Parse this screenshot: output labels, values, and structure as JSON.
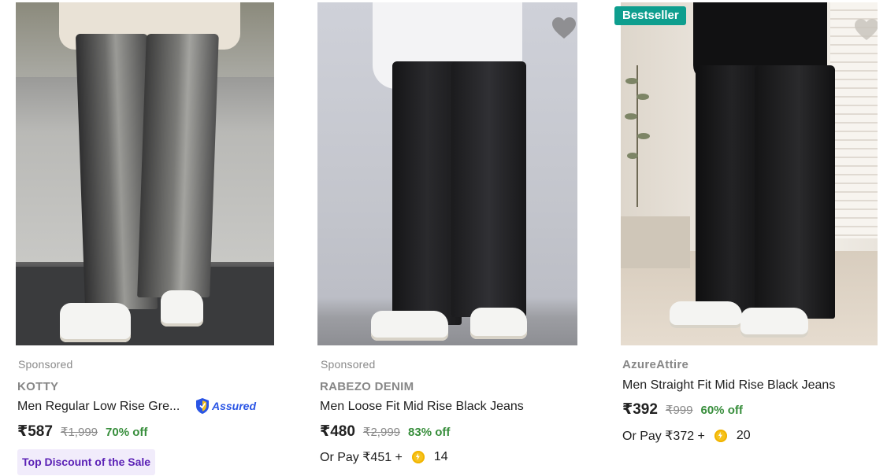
{
  "products": [
    {
      "sponsored_label": "Sponsored",
      "brand": "KOTTY",
      "title": "Men Regular Low Rise Gre...",
      "assured_label": "Assured",
      "price": "₹587",
      "mrp": "₹1,999",
      "discount": "70% off",
      "tag": "Top Discount of the Sale",
      "image_icon": "product-photo-grey-baggy-jeans"
    },
    {
      "sponsored_label": "Sponsored",
      "brand": "RABEZO DENIM",
      "title": "Men Loose Fit Mid Rise Black Jeans",
      "price": "₹480",
      "mrp": "₹2,999",
      "discount": "83% off",
      "or_pay_label": "Or Pay ₹451 +",
      "coins": "14",
      "wishlist_icon": "heart-icon",
      "image_icon": "product-photo-black-loose-jeans"
    },
    {
      "badge": "Bestseller",
      "brand": "AzureAttire",
      "title": "Men Straight Fit Mid Rise Black Jeans",
      "price": "₹392",
      "mrp": "₹999",
      "discount": "60% off",
      "or_pay_label": "Or Pay ₹372 +",
      "coins": "20",
      "wishlist_icon": "heart-icon",
      "image_icon": "product-photo-black-straight-jeans"
    }
  ],
  "colors": {
    "discount_green": "#388e3c",
    "bestseller_teal": "#0e9e8e",
    "assured_blue": "#2a55e5",
    "tag_purple": "#5b21b6",
    "coin_yellow": "#f6c21c"
  }
}
